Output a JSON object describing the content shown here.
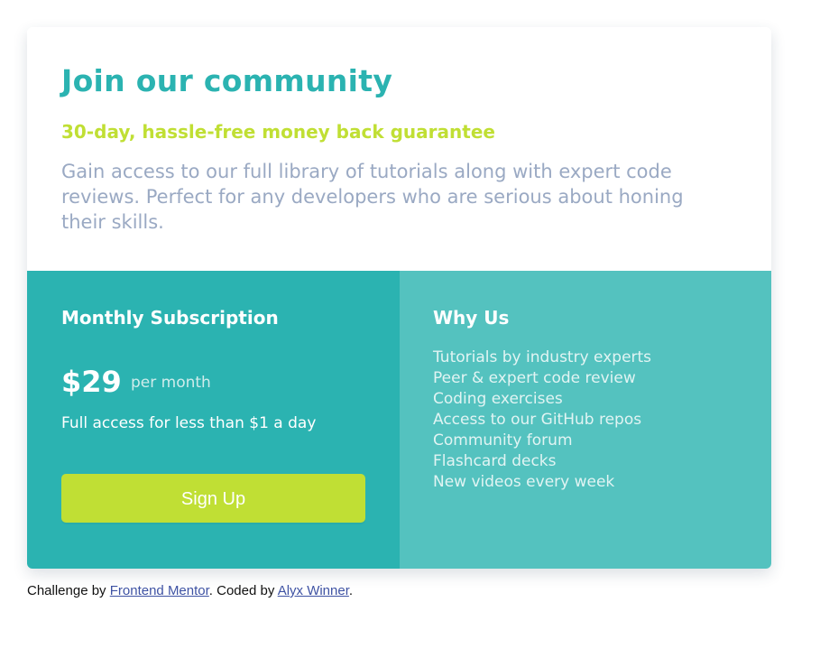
{
  "header": {
    "title": "Join our community",
    "subtitle": "30-day, hassle-free money back guarantee",
    "description": "Gain access to our full library of tutorials along with expert code reviews. Perfect for any developers who are serious about honing their skills."
  },
  "subscription": {
    "title": "Monthly Subscription",
    "price": "$29",
    "period": "per month",
    "note": "Full access for less than $1 a day",
    "button_label": "Sign Up"
  },
  "why_us": {
    "title": "Why Us",
    "items": [
      "Tutorials by industry experts",
      "Peer & expert code review",
      "Coding exercises",
      "Access to our GitHub repos",
      "Community forum",
      "Flashcard decks",
      "New videos every week"
    ]
  },
  "attribution": {
    "prefix": "Challenge by ",
    "challenge_link": "Frontend Mentor",
    "middle": ". Coded by ",
    "author_link": "Alyx Winner",
    "suffix": "."
  },
  "colors": {
    "accent_teal": "#2bb3b1",
    "secondary_teal": "#54c2bf",
    "accent_lime": "#c0df34",
    "text_gray_blue": "#9aa9c3",
    "link_blue": "#3e52a3"
  }
}
